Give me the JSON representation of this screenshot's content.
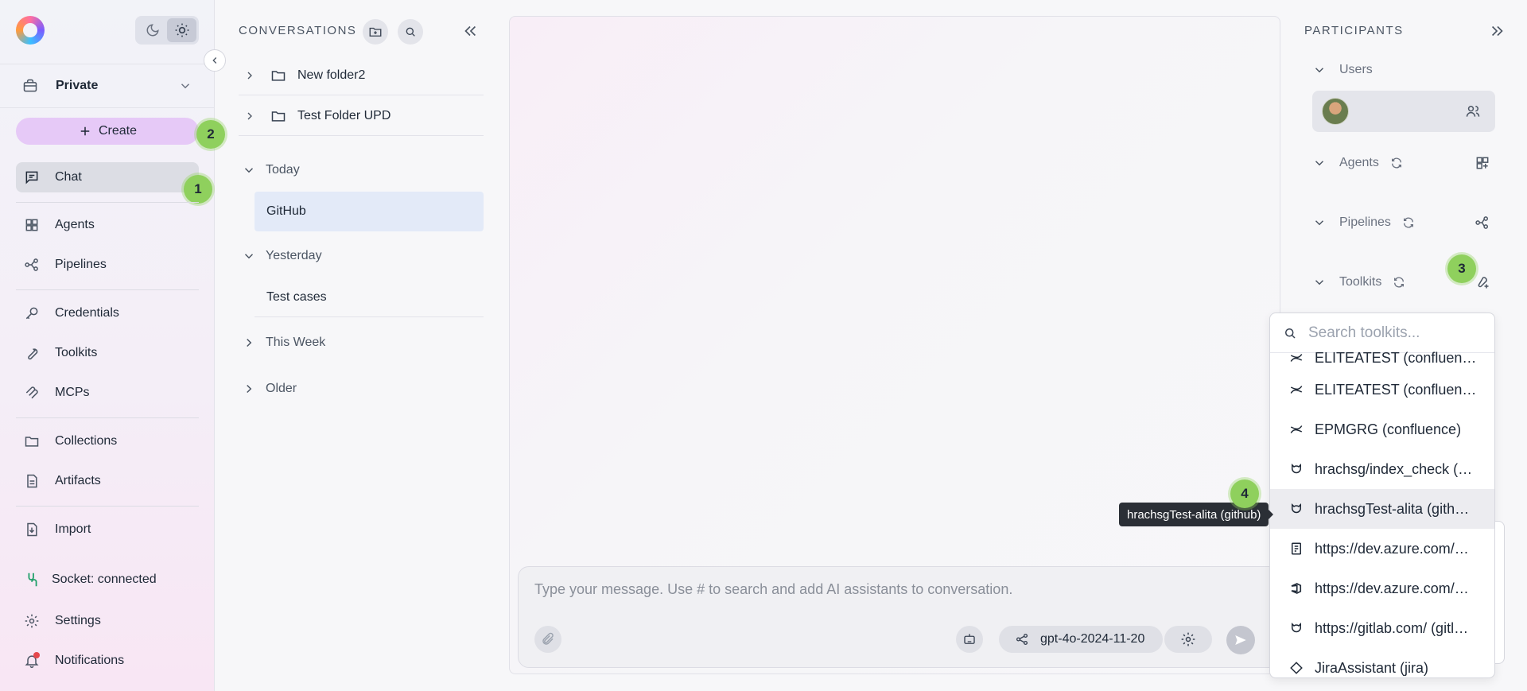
{
  "sidebar": {
    "workspace": "Private",
    "create_label": "Create",
    "nav": [
      {
        "label": "Chat"
      },
      {
        "label": "Agents"
      },
      {
        "label": "Pipelines"
      },
      {
        "label": "Credentials"
      },
      {
        "label": "Toolkits"
      },
      {
        "label": "MCPs"
      },
      {
        "label": "Collections"
      },
      {
        "label": "Artifacts"
      },
      {
        "label": "Import"
      }
    ],
    "socket_status": "Socket: connected",
    "settings_label": "Settings",
    "notifications_label": "Notifications"
  },
  "conversations": {
    "title": "CONVERSATIONS",
    "folders": [
      "New folder2",
      "Test Folder UPD"
    ],
    "groups": {
      "today": "Today",
      "yesterday": "Yesterday",
      "this_week": "This Week",
      "older": "Older"
    },
    "today_items": [
      "GitHub"
    ],
    "yesterday_items": [
      "Test cases"
    ]
  },
  "composer": {
    "placeholder": "Type your message. Use # to search and add AI assistants to conversation.",
    "model": "gpt-4o-2024-11-20"
  },
  "participants": {
    "title": "PARTICIPANTS",
    "sections": {
      "users": "Users",
      "agents": "Agents",
      "pipelines": "Pipelines",
      "toolkits": "Toolkits"
    }
  },
  "toolkit_dropdown": {
    "search_placeholder": "Search toolkits...",
    "items": [
      {
        "label": "ELITEATEST (confluen…",
        "icon": "confluence-icon"
      },
      {
        "label": "ELITEATEST (confluen…",
        "icon": "confluence-icon"
      },
      {
        "label": "EPMGRG (confluence)",
        "icon": "confluence-icon"
      },
      {
        "label": "hrachsg/index_check (…",
        "icon": "github-icon"
      },
      {
        "label": "hrachsgTest-alita (gith…",
        "icon": "github-icon"
      },
      {
        "label": "https://dev.azure.com/…",
        "icon": "azure-boards-icon"
      },
      {
        "label": "https://dev.azure.com/…",
        "icon": "azure-devops-icon"
      },
      {
        "label": "https://gitlab.com/ (gitl…",
        "icon": "gitlab-icon"
      },
      {
        "label": "JiraAssistant (jira)",
        "icon": "jira-icon"
      }
    ]
  },
  "tooltip": "hrachsgTest-alita (github)",
  "badges": [
    "1",
    "2",
    "3",
    "4"
  ],
  "colors": {
    "accent_create": "#e6c9f7",
    "badge": "#8fd05d",
    "selected_conversation": "#e3eaf8",
    "socket_icon": "#22a06b",
    "notification_dot": "#e5484d"
  }
}
